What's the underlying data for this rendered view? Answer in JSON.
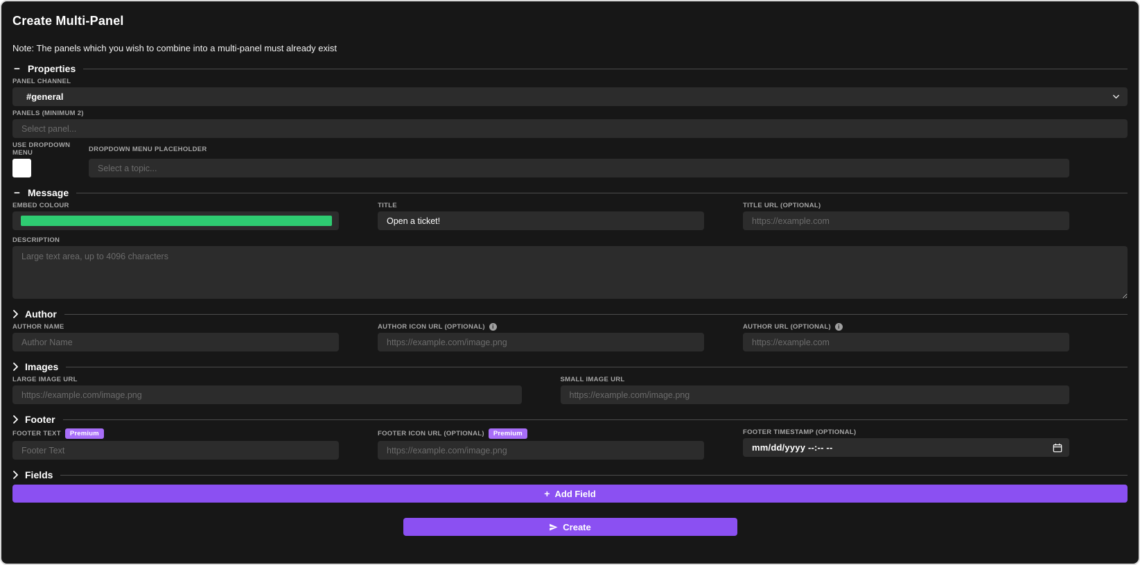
{
  "page": {
    "title": "Create Multi-Panel",
    "note": "Note: The panels which you wish to combine into a multi-panel must already exist"
  },
  "colors": {
    "accent": "#8b50f2",
    "premium_badge": "#a86ef8",
    "embed_colour": "#2ecc71",
    "background": "#171717",
    "input_background": "#2c2c2c"
  },
  "icons": {
    "minus": "−",
    "plus": "+",
    "info": "i"
  },
  "sections": {
    "properties": {
      "label": "Properties",
      "panel_channel_label": "PANEL CHANNEL",
      "panel_channel_value": "#general",
      "panels_label": "PANELS (MINIMUM 2)",
      "panels_placeholder": "Select panel...",
      "use_dropdown_label": "USE DROPDOWN MENU",
      "dropdown_placeholder_label": "DROPDOWN MENU PLACEHOLDER",
      "dropdown_placeholder": "Select a topic..."
    },
    "message": {
      "label": "Message",
      "embed_colour_label": "EMBED COLOUR",
      "title_label": "TITLE",
      "title_value": "Open a ticket!",
      "title_url_label": "TITLE URL (OPTIONAL)",
      "title_url_placeholder": "https://example.com",
      "description_label": "DESCRIPTION",
      "description_placeholder": "Large text area, up to 4096 characters"
    },
    "author": {
      "label": "Author",
      "name_label": "AUTHOR NAME",
      "name_placeholder": "Author Name",
      "icon_url_label": "AUTHOR ICON URL (OPTIONAL)",
      "icon_url_placeholder": "https://example.com/image.png",
      "url_label": "AUTHOR URL (OPTIONAL)",
      "url_placeholder": "https://example.com"
    },
    "images": {
      "label": "Images",
      "large_label": "LARGE IMAGE URL",
      "large_placeholder": "https://example.com/image.png",
      "small_label": "SMALL IMAGE URL",
      "small_placeholder": "https://example.com/image.png"
    },
    "footer": {
      "label": "Footer",
      "premium_badge": "Premium",
      "text_label": "FOOTER TEXT",
      "text_placeholder": "Footer Text",
      "icon_url_label": "FOOTER ICON URL (OPTIONAL)",
      "icon_url_placeholder": "https://example.com/image.png",
      "timestamp_label": "FOOTER TIMESTAMP (OPTIONAL)",
      "timestamp_value": "mm/dd/yyyy --:-- --"
    },
    "fields": {
      "label": "Fields",
      "add_field_label": "Add Field"
    }
  },
  "create_button": {
    "label": "Create"
  }
}
